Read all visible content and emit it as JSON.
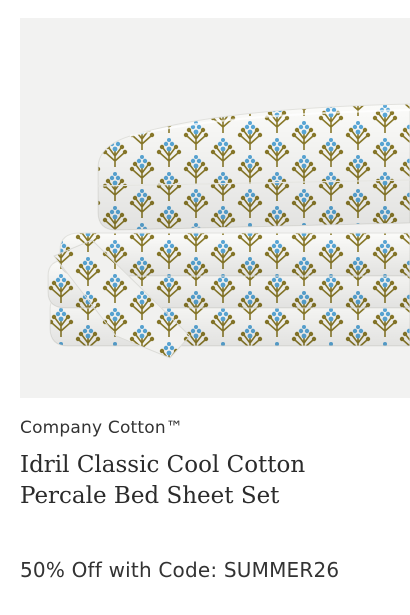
{
  "product": {
    "image_alt": "Idril Classic Cool Cotton Percale Bed Sheet Set",
    "brand": "Company Cotton™",
    "title": "Idril Classic Cool Cotton Percale Bed Sheet Set",
    "promo": "50% Off with Code: SUMMER26"
  },
  "colors": {
    "image_background": "#f2f2f1",
    "fabric": "#fbfbf9",
    "motif_olive": "#8a7a2a",
    "motif_blue": "#5aa8d8",
    "text": "#333333"
  }
}
